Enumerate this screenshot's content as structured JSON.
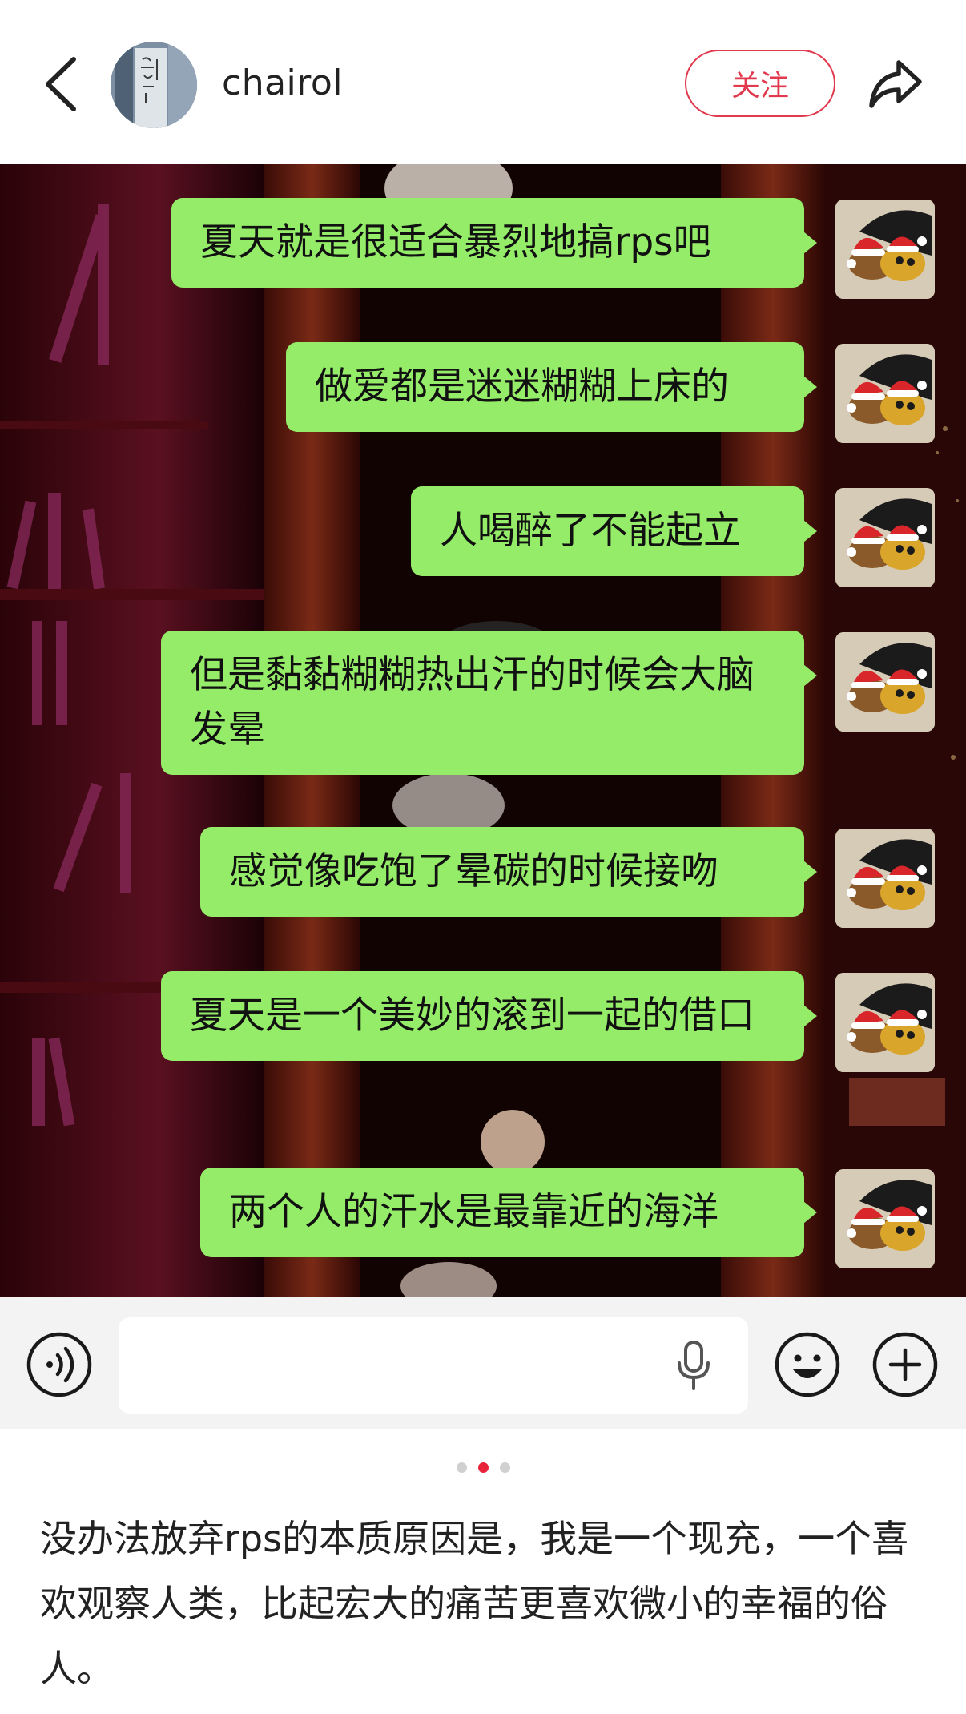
{
  "header": {
    "username": "chairol",
    "follow_label": "关注",
    "icons": [
      "back-arrow-icon",
      "share-arrow-icon"
    ]
  },
  "chat": {
    "bubble_color": "#95ec69",
    "messages": [
      {
        "text": "夏天就是很适合暴烈地搞rps吧"
      },
      {
        "text": "做爱都是迷迷糊糊上床的"
      },
      {
        "text": "人喝醉了不能起立"
      },
      {
        "text": "但是黏黏糊糊热出汗的时候会大脑发晕"
      },
      {
        "text": "感觉像吃饱了晕碳的时候接吻"
      },
      {
        "text": "夏天是一个美妙的滚到一起的借口"
      },
      {
        "text": "两个人的汗水是最靠近的海洋"
      }
    ]
  },
  "input_bar": {
    "icons": [
      "voice-icon",
      "microphone-icon",
      "emoji-icon",
      "plus-icon"
    ]
  },
  "pagination": {
    "total": 3,
    "current": 2,
    "active_color": "#e8243a"
  },
  "caption": "没办法放弃rps的本质原因是，我是一个现充，一个喜欢观察人类，比起宏大的痛苦更喜欢微小的幸福的俗人。"
}
